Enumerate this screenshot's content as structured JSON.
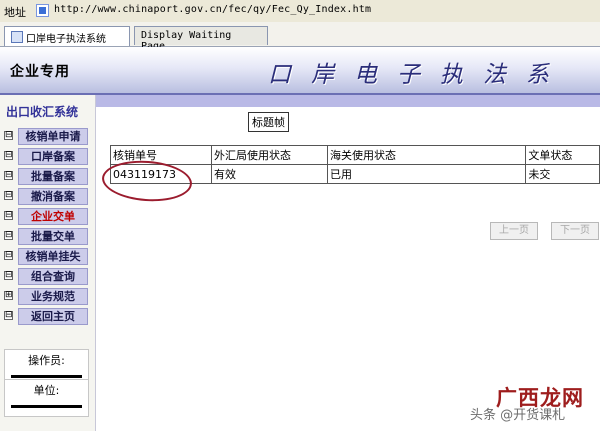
{
  "address_bar": {
    "label": "地址",
    "url": "http://www.chinaport.gov.cn/fec/qy/Fec_Qy_Index.htm"
  },
  "tabs": [
    {
      "label": "口岸电子执法系统",
      "active": true
    },
    {
      "label": "Display Waiting Page",
      "active": false
    }
  ],
  "header": {
    "section": "企业专用",
    "title": "口岸电子执法系统"
  },
  "sidebar": {
    "title": "出口收汇系统",
    "items": [
      {
        "label": "核销单申请",
        "toggle": "⊟"
      },
      {
        "label": "口岸备案",
        "toggle": "⊟"
      },
      {
        "label": "批量备案",
        "toggle": "⊟"
      },
      {
        "label": "撤消备案",
        "toggle": "⊟"
      },
      {
        "label": "企业交单",
        "toggle": "⊟"
      },
      {
        "label": "批量交单",
        "toggle": "⊟"
      },
      {
        "label": "核销单挂失",
        "toggle": "⊟"
      },
      {
        "label": "组合查询",
        "toggle": "⊟"
      },
      {
        "label": "业务规范",
        "toggle": "⊞"
      },
      {
        "label": "返回主页",
        "toggle": "⊟"
      }
    ],
    "active_index": 4,
    "operator_label": "操作员:",
    "unit_label": "单位:"
  },
  "main": {
    "frame_title": "标题帧",
    "columns": [
      "核销单号",
      "外汇局使用状态",
      "海关使用状态",
      "文单状态"
    ],
    "rows": [
      [
        "043119173",
        "有效",
        "已用",
        "未交"
      ]
    ],
    "prev_label": "上一页",
    "next_label": "下一页"
  },
  "watermark": {
    "big": "广西龙网",
    "small": "头条 @开货课札"
  },
  "colors": {
    "header_border": "#6b6fb4",
    "sidebar_button": "#ccccea",
    "active_item": "#c00000",
    "annotation_circle": "#9b1c2e"
  }
}
